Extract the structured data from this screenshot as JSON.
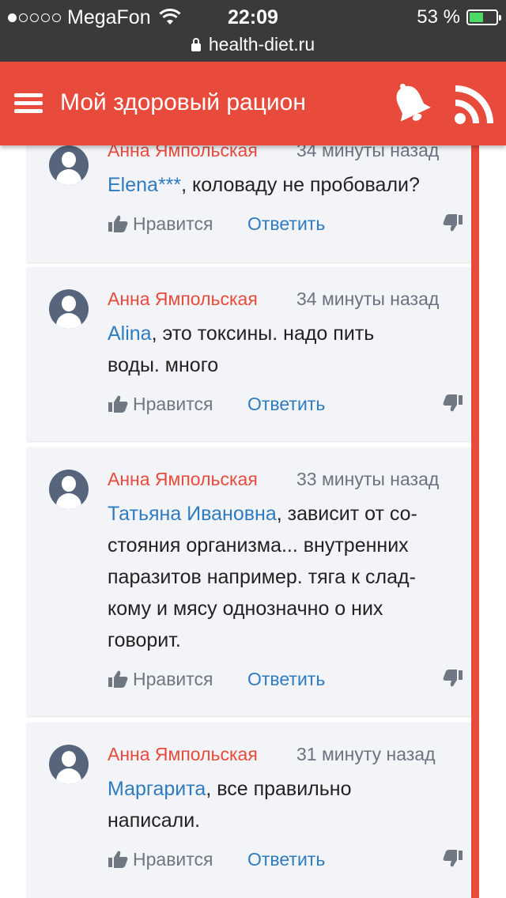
{
  "statusbar": {
    "carrier": "MegaFon",
    "time": "22:09",
    "battery": "53 %",
    "battery_level": 0.53,
    "url": "health-diet.ru"
  },
  "header": {
    "title": "Мой здоровый рацион"
  },
  "colors": {
    "accent": "#e84a3c",
    "link": "#2f7bc0",
    "card_bg": "#f2f4f7",
    "avatar": "#56647c"
  },
  "comments": [
    {
      "author": "Анна Ямпольская",
      "time": "34 минуты назад",
      "mention": "Elena***",
      "lines": [
        ", коловаду не пробовали?"
      ],
      "like_label": "Нравится",
      "reply_label": "Ответить"
    },
    {
      "author": "Анна Ямпольская",
      "time": "34 минуты назад",
      "mention": "Alina",
      "lines": [
        ", это токсины. надо пить",
        "воды. много"
      ],
      "like_label": "Нравится",
      "reply_label": "Ответить"
    },
    {
      "author": "Анна Ямпольская",
      "time": "33 минуты назад",
      "mention": "Татьяна Ивановна",
      "lines": [
        ", зависит от со-",
        "стояния организма... внутренних",
        "паразитов например. тяга к слад-",
        "кому и мясу однозначно о них",
        "говорит."
      ],
      "like_label": "Нравится",
      "reply_label": "Ответить"
    },
    {
      "author": "Анна Ямпольская",
      "time": "31 минуту назад",
      "mention": "Маргарита",
      "lines": [
        ", все правильно",
        "написали."
      ],
      "like_label": "Нравится",
      "reply_label": "Ответить"
    }
  ]
}
